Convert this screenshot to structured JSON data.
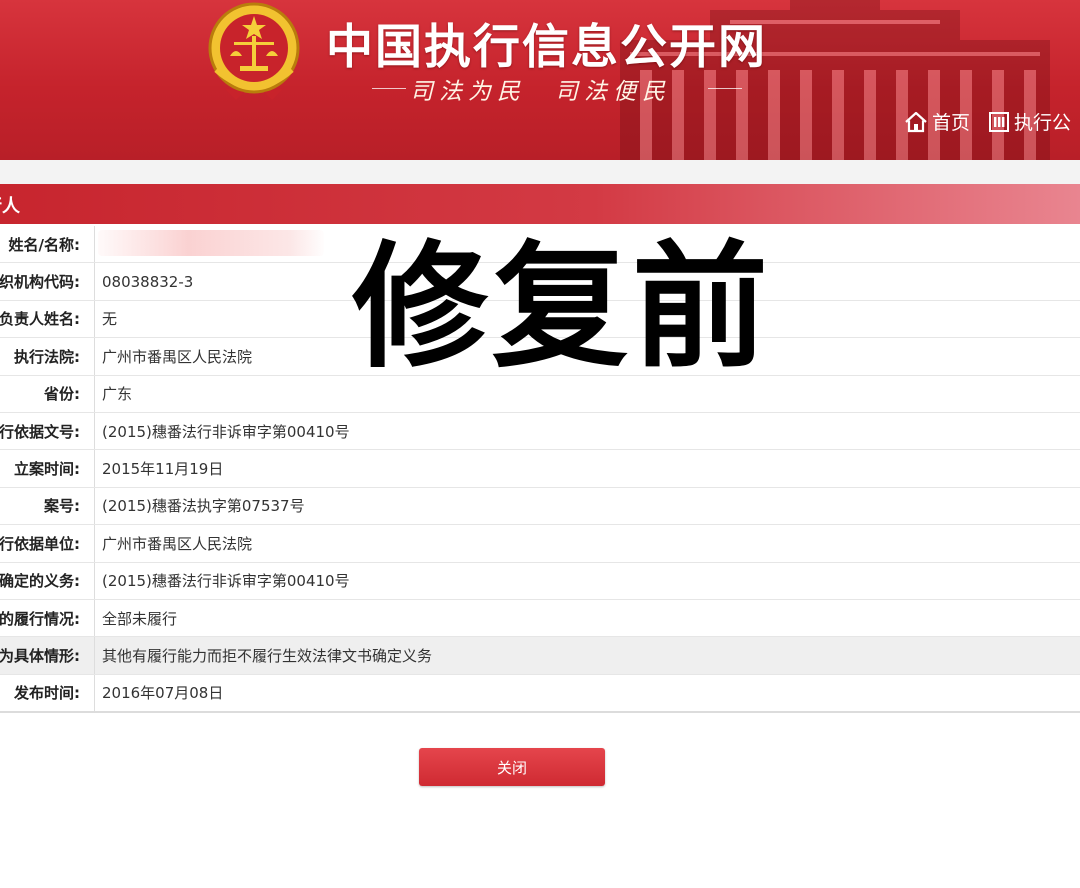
{
  "header": {
    "title": "中国执行信息公开网",
    "slogan": "司法为民　司法便民",
    "nav": {
      "home": "首页",
      "exec": "执行公"
    }
  },
  "section": {
    "title": "行人"
  },
  "overlay": {
    "text": "修复前"
  },
  "details": [
    {
      "label": "姓名/名称:",
      "value": ""
    },
    {
      "label": "织机构代码:",
      "value": "08038832-3"
    },
    {
      "label": "负责人姓名:",
      "value": "无"
    },
    {
      "label": "执行法院:",
      "value": "广州市番禺区人民法院"
    },
    {
      "label": "省份:",
      "value": "广东"
    },
    {
      "label": "行依据文号:",
      "value": "(2015)穗番法行非诉审字第00410号"
    },
    {
      "label": "立案时间:",
      "value": "2015年11月19日"
    },
    {
      "label": "案号:",
      "value": "(2015)穗番法执字第07537号"
    },
    {
      "label": "行依据单位:",
      "value": "广州市番禺区人民法院"
    },
    {
      "label": "确定的义务:",
      "value": "(2015)穗番法行非诉审字第00410号"
    },
    {
      "label": "的履行情况:",
      "value": "全部未履行"
    },
    {
      "label": "为具体情形:",
      "value": "其他有履行能力而拒不履行生效法律文书确定义务"
    },
    {
      "label": "发布时间:",
      "value": "2016年07月08日"
    }
  ],
  "actions": {
    "close_label": "关闭"
  },
  "colors": {
    "brand_red": "#c5232c",
    "button_red": "#d9343c"
  }
}
